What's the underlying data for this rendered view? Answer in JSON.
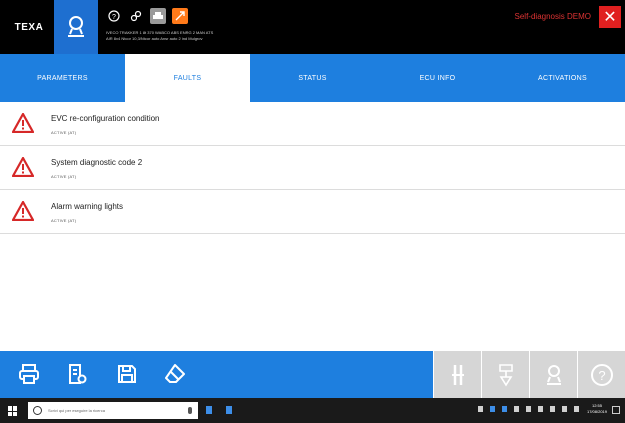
{
  "header": {
    "brand": "TEXA",
    "vehicle_info_line1": "IVECO TRAKKER 1 8t 370 WABCO ABS ENRG 2 MAN ATS",
    "vehicle_info_line2": "AIR 8x4 Ntcor 10,3/Ntcor auto Ansr auto 2 ind Mulgrov",
    "self_diagnosis": "Self-diagnosis DEMO",
    "close_glyph": "✕",
    "icons": [
      "help-icon",
      "link-icon",
      "car-icon",
      "diagnosis-icon"
    ]
  },
  "tabs": [
    {
      "label": "PARAMETERS",
      "active": false
    },
    {
      "label": "FAULTS",
      "active": true
    },
    {
      "label": "STATUS",
      "active": false
    },
    {
      "label": "ECU INFO",
      "active": false
    },
    {
      "label": "ACTIVATIONS",
      "active": false
    }
  ],
  "faults": [
    {
      "title": "EVC re-configuration condition",
      "status": "ACTIVE (AT)"
    },
    {
      "title": "System diagnostic code 2",
      "status": "ACTIVE (AT)"
    },
    {
      "title": "Alarm warning lights",
      "status": "ACTIVE (AT)"
    }
  ],
  "toolbar": {
    "left_tools": [
      "print-icon",
      "report-icon",
      "save-icon",
      "clear-icon"
    ],
    "right_tools": [
      "tools-icon",
      "ecu-icon",
      "user-icon",
      "help-icon"
    ]
  },
  "taskbar": {
    "search_placeholder": "Scrivi qui per eseguire la ricerca",
    "time": "12:55",
    "date": "17/08/2019"
  },
  "colors": {
    "accent": "#1e7fdf",
    "header": "#000000",
    "warning": "#d62828",
    "close": "#e02020"
  }
}
